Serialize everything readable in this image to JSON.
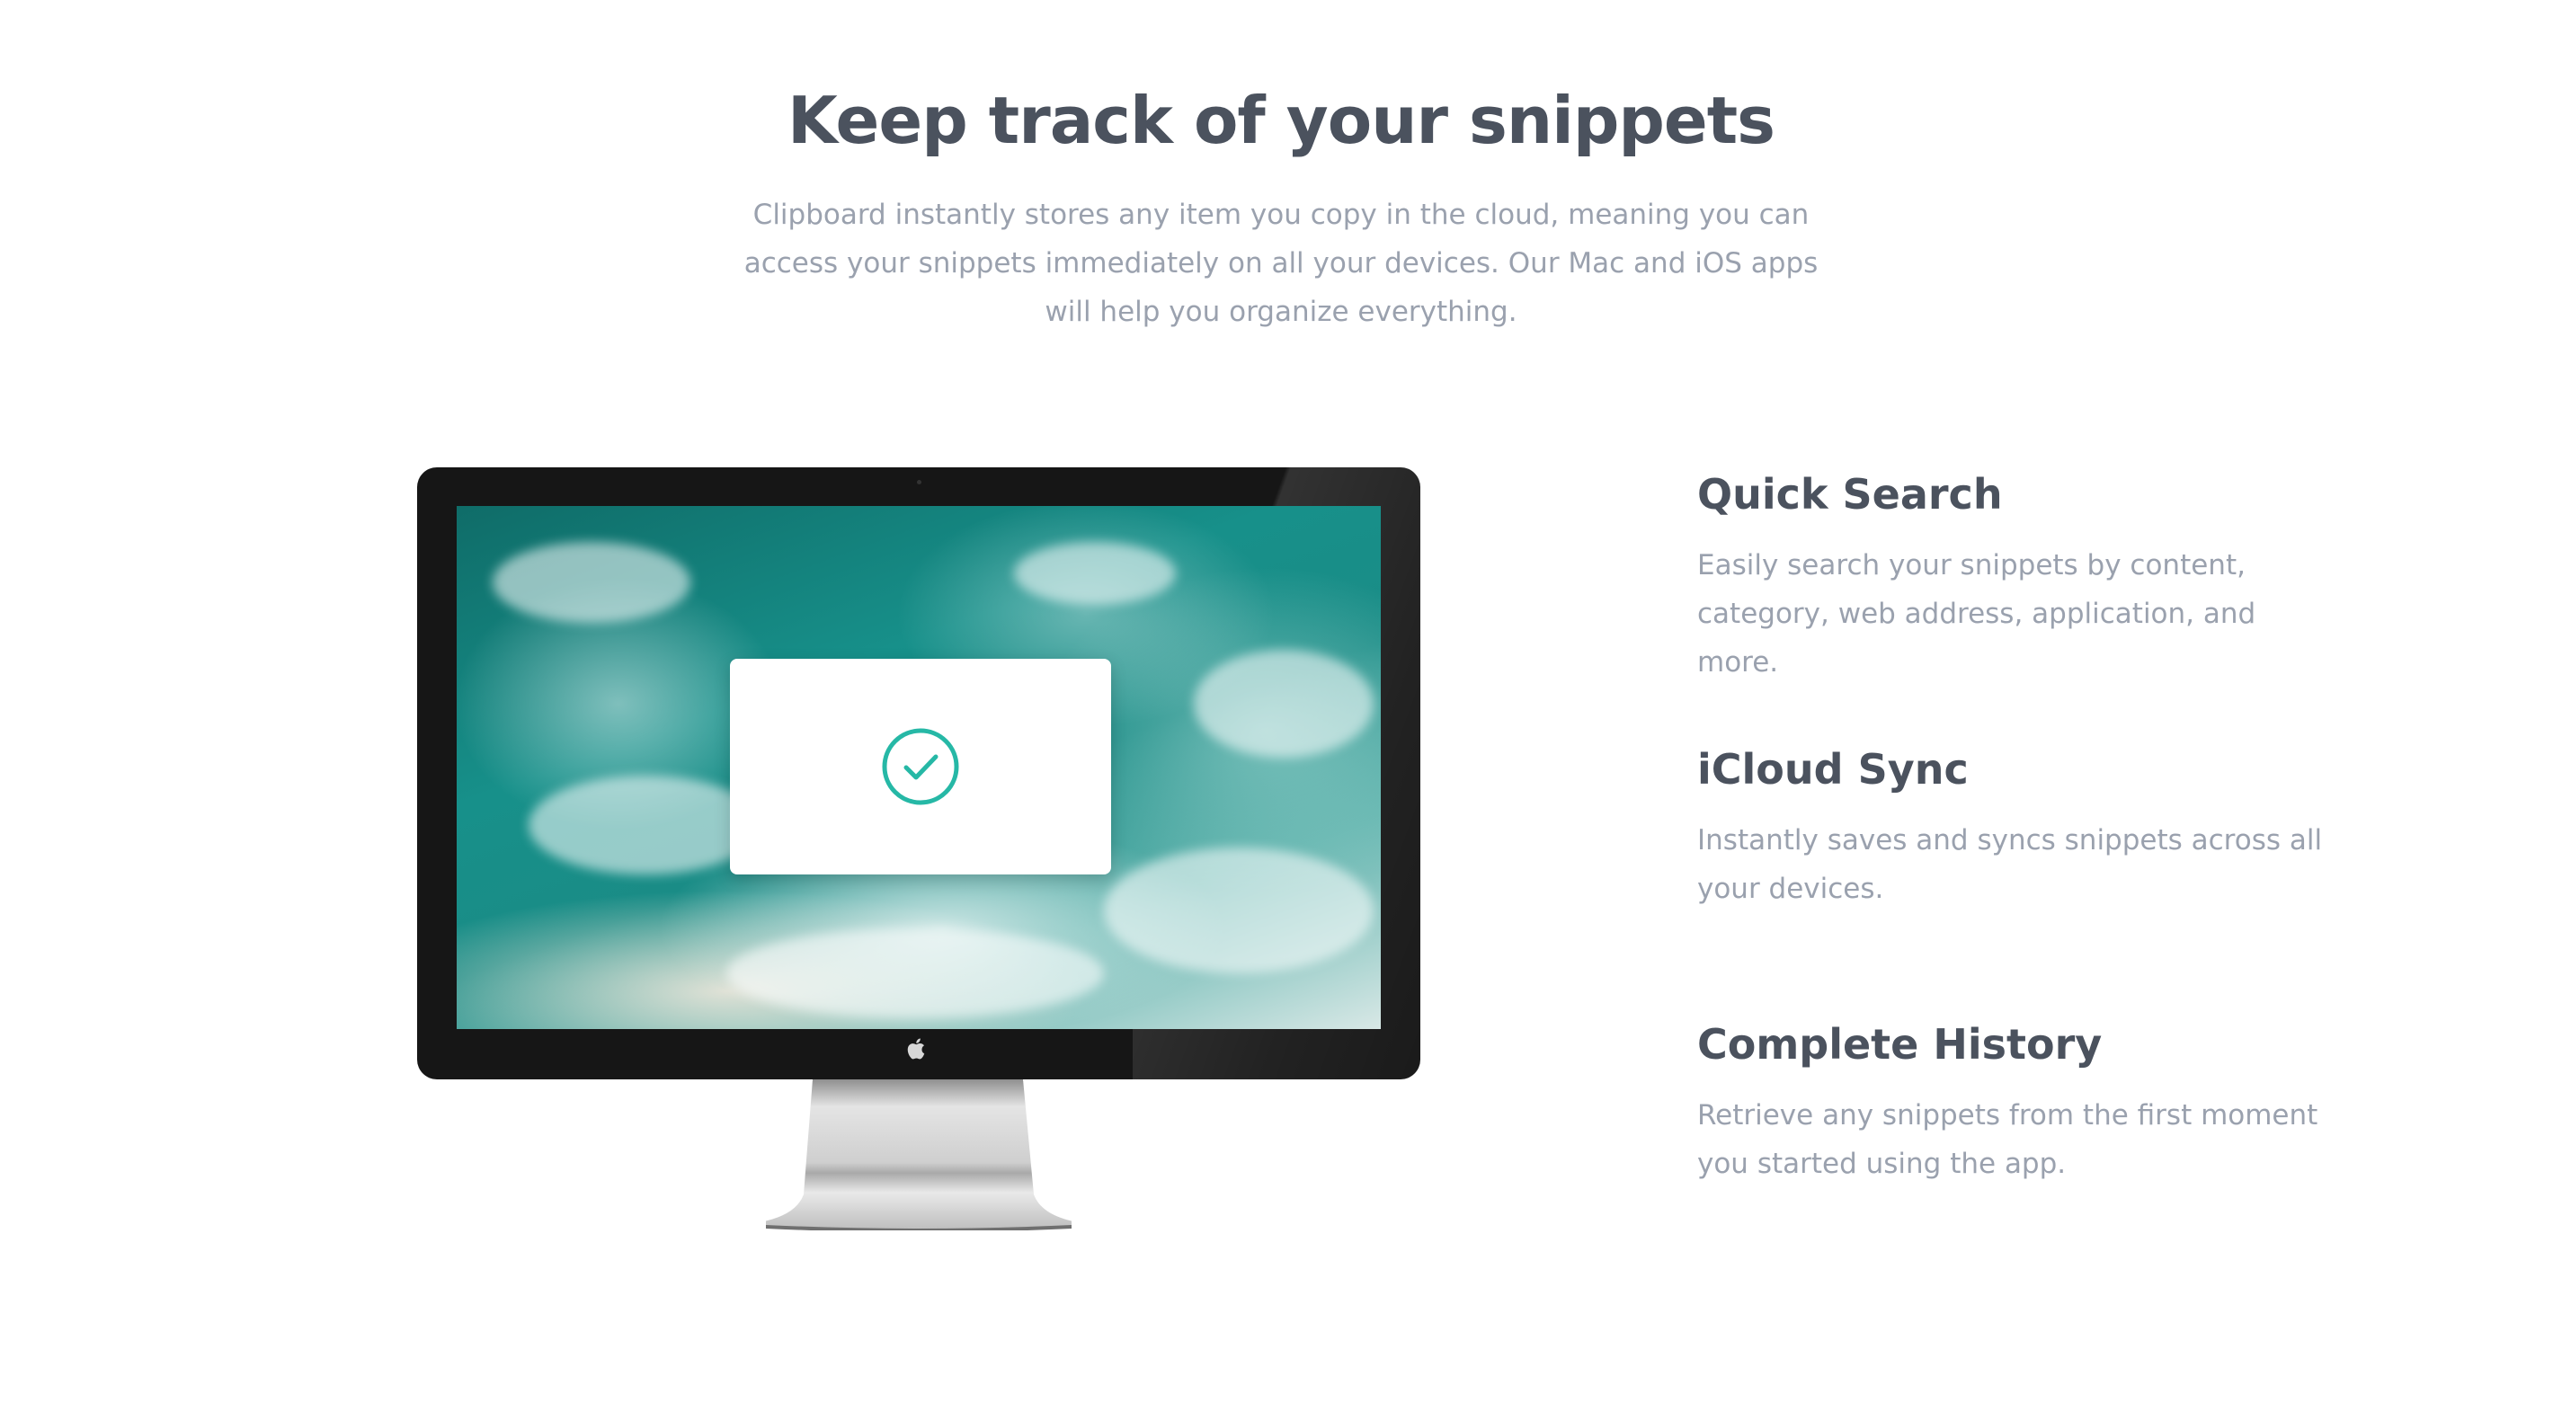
{
  "hero": {
    "title": "Keep track of your snippets",
    "description": "Clipboard instantly stores any item you copy in the cloud, meaning you can access your snippets immediately on all your devices. Our Mac and iOS apps will help you organize everything."
  },
  "monitor": {
    "screen_icon": "checkmark-circle-icon",
    "logo_icon": "apple-logo-icon",
    "accent_color": "#26b8a6"
  },
  "features": [
    {
      "title": "Quick Search",
      "description": "Easily search your snippets by content, category, web address, application, and more."
    },
    {
      "title": "iCloud Sync",
      "description": "Instantly saves and syncs snippets across all your devices."
    },
    {
      "title": "Complete History",
      "description": "Retrieve any snippets from the first moment you started using the app."
    }
  ],
  "colors": {
    "heading": "#4b525e",
    "body_text": "#9aa1ae",
    "background": "#ffffff"
  }
}
